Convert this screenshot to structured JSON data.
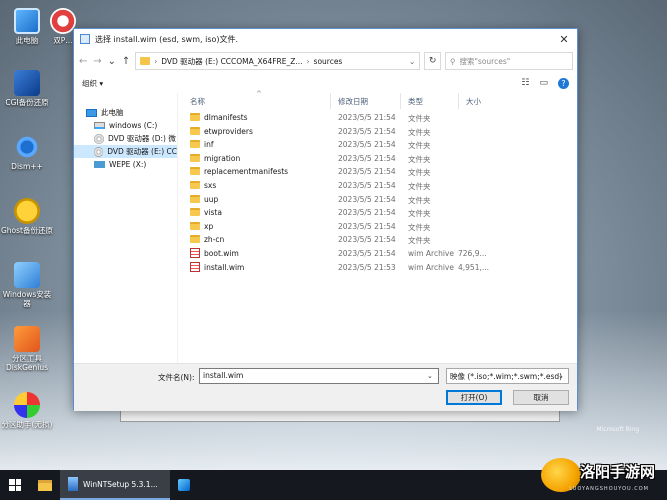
{
  "desktop": {
    "icons": [
      {
        "label": "此电脑",
        "icon": "computer-icon"
      },
      {
        "label": "双P…",
        "icon": "lifebuoy-icon"
      },
      {
        "label": "CGI备份还原",
        "icon": "cgi-icon"
      },
      {
        "label": "Dism++",
        "icon": "gear-icon"
      },
      {
        "label": "Ghost备份还原",
        "icon": "ghost-icon"
      },
      {
        "label": "Windows安装器",
        "icon": "windows-installer-icon"
      },
      {
        "label": "分区工具DiskGenius",
        "icon": "diskgenius-icon"
      },
      {
        "label": "分区助手(无损)",
        "icon": "partition-assistant-icon"
      }
    ]
  },
  "dialog": {
    "title": "选择 install.wim (esd, swm, iso)文件.",
    "address": {
      "segments": [
        "DVD 驱动器 (E:) CCCOMA_X64FRE_Z...",
        "sources"
      ]
    },
    "search_placeholder": "搜索\"sources\"",
    "organize_label": "组织 ▾",
    "tree": [
      {
        "label": "此电脑",
        "icon": "computer-icon"
      },
      {
        "label": "windows (C:)",
        "icon": "drive-icon"
      },
      {
        "label": "DVD 驱动器 (D:) 微",
        "icon": "dvd-icon"
      },
      {
        "label": "DVD 驱动器 (E:) CC",
        "icon": "dvd-icon",
        "selected": true
      },
      {
        "label": "WEPE (X:)",
        "icon": "network-drive-icon"
      }
    ],
    "columns": {
      "name": "名称",
      "date": "修改日期",
      "type": "类型",
      "size": "大小"
    },
    "files": [
      {
        "name": "dlmanifests",
        "date": "2023/5/5 21:54",
        "type": "文件夹",
        "size": "",
        "icon": "folder-icon"
      },
      {
        "name": "etwproviders",
        "date": "2023/5/5 21:54",
        "type": "文件夹",
        "size": "",
        "icon": "folder-icon"
      },
      {
        "name": "inf",
        "date": "2023/5/5 21:54",
        "type": "文件夹",
        "size": "",
        "icon": "folder-icon"
      },
      {
        "name": "migration",
        "date": "2023/5/5 21:54",
        "type": "文件夹",
        "size": "",
        "icon": "folder-icon"
      },
      {
        "name": "replacementmanifests",
        "date": "2023/5/5 21:54",
        "type": "文件夹",
        "size": "",
        "icon": "folder-icon"
      },
      {
        "name": "sxs",
        "date": "2023/5/5 21:54",
        "type": "文件夹",
        "size": "",
        "icon": "folder-icon"
      },
      {
        "name": "uup",
        "date": "2023/5/5 21:54",
        "type": "文件夹",
        "size": "",
        "icon": "folder-icon"
      },
      {
        "name": "vista",
        "date": "2023/5/5 21:54",
        "type": "文件夹",
        "size": "",
        "icon": "folder-icon"
      },
      {
        "name": "xp",
        "date": "2023/5/5 21:54",
        "type": "文件夹",
        "size": "",
        "icon": "folder-icon"
      },
      {
        "name": "zh-cn",
        "date": "2023/5/5 21:54",
        "type": "文件夹",
        "size": "",
        "icon": "folder-icon"
      },
      {
        "name": "boot.wim",
        "date": "2023/5/5 21:54",
        "type": "wim Archive",
        "size": "726,9...",
        "icon": "wim-archive-icon"
      },
      {
        "name": "install.wim",
        "date": "2023/5/5 21:53",
        "type": "wim Archive",
        "size": "4,951,...",
        "icon": "wim-archive-icon"
      }
    ],
    "filename_label": "文件名(N):",
    "filename_value": "install.wim",
    "filter_value": "映像 (*.iso;*.wim;*.swm;*.esd)",
    "open_label": "打开(O)",
    "cancel_label": "取消"
  },
  "taskbar": {
    "task_label": "WinNTSetup 5.3.1..."
  },
  "watermark": {
    "brand": "洛阳手游网",
    "sub": "LUOYANGSHOUYOU.COM",
    "bing": "Microsoft Bing"
  }
}
